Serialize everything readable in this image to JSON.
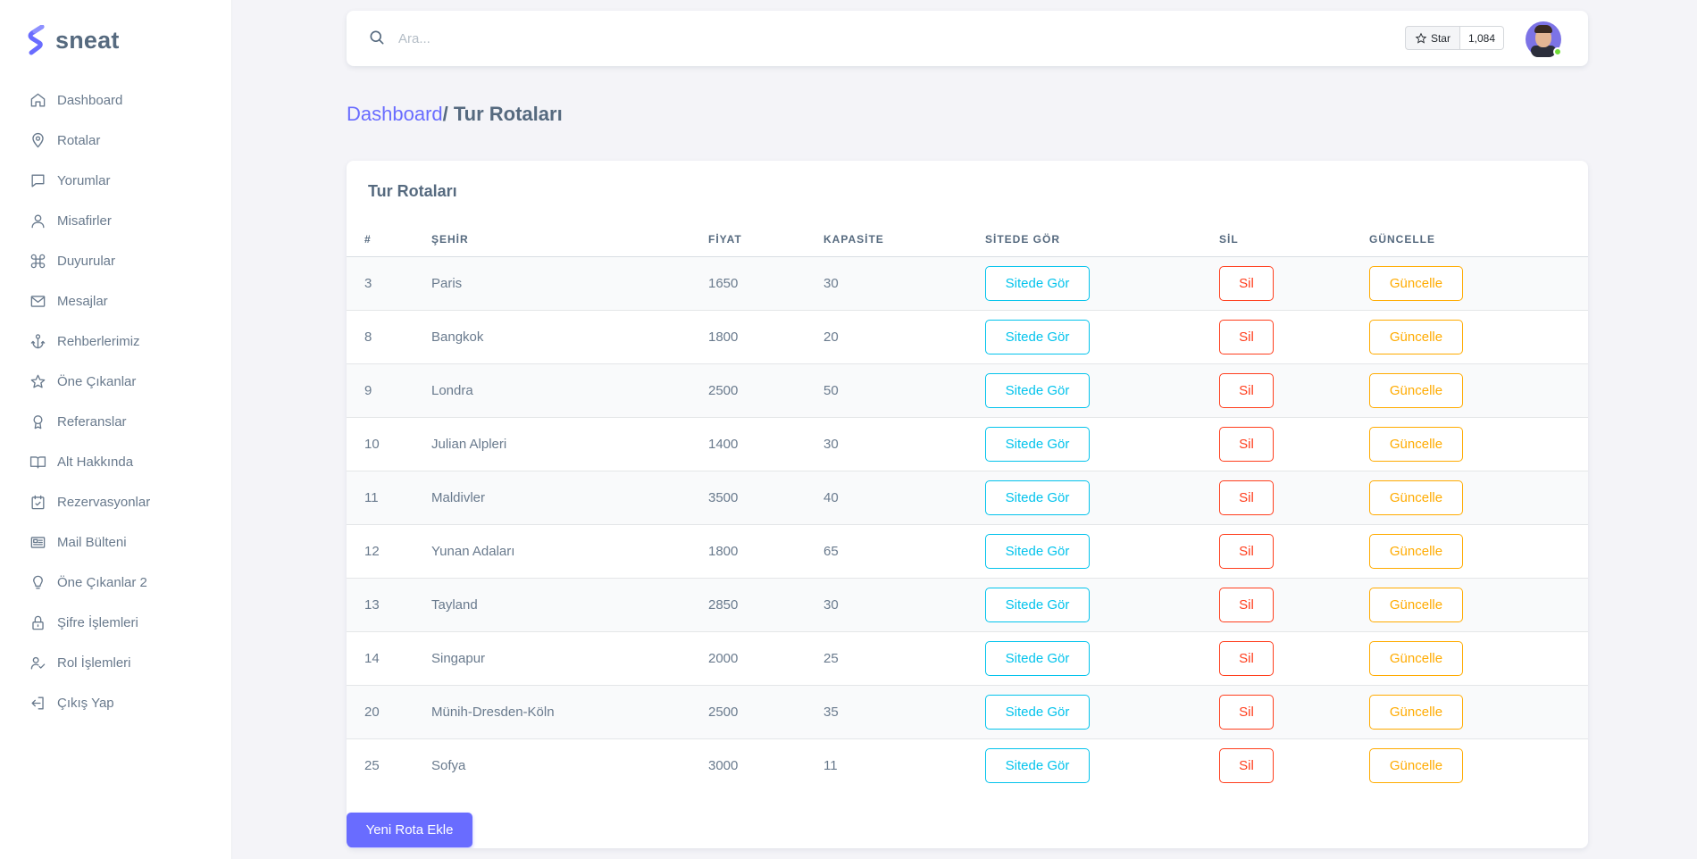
{
  "brand": {
    "name": "sneat"
  },
  "sidebar": {
    "items": [
      {
        "label": "Dashboard",
        "icon": "home-icon"
      },
      {
        "label": "Rotalar",
        "icon": "map-pin-icon"
      },
      {
        "label": "Yorumlar",
        "icon": "message-square-icon"
      },
      {
        "label": "Misafirler",
        "icon": "user-icon"
      },
      {
        "label": "Duyurular",
        "icon": "command-icon"
      },
      {
        "label": "Mesajlar",
        "icon": "envelope-icon"
      },
      {
        "label": "Rehberlerimiz",
        "icon": "anchor-icon"
      },
      {
        "label": "Öne Çıkanlar",
        "icon": "star-icon"
      },
      {
        "label": "Referanslar",
        "icon": "award-icon"
      },
      {
        "label": "Alt Hakkında",
        "icon": "book-open-icon"
      },
      {
        "label": "Rezervasyonlar",
        "icon": "calendar-check-icon"
      },
      {
        "label": "Mail Bülteni",
        "icon": "news-icon"
      },
      {
        "label": "Öne Çıkanlar 2",
        "icon": "bulb-icon"
      },
      {
        "label": "Şifre İşlemleri",
        "icon": "lock-icon"
      },
      {
        "label": "Rol İşlemleri",
        "icon": "user-check-icon"
      },
      {
        "label": "Çıkış Yap",
        "icon": "log-out-icon"
      }
    ]
  },
  "navbar": {
    "search_placeholder": "Ara...",
    "github": {
      "star_label": "Star",
      "count": "1,084"
    }
  },
  "breadcrumb": {
    "parent": "Dashboard",
    "current": "/ Tur Rotaları"
  },
  "card": {
    "title": "Tur Rotaları",
    "columns": [
      "#",
      "ŞEHİR",
      "FİYAT",
      "KAPASİTE",
      "SİTEDE GÖR",
      "SİL",
      "GÜNCELLE"
    ],
    "rows": [
      {
        "id": "3",
        "city": "Paris",
        "price": "1650",
        "capacity": "30"
      },
      {
        "id": "8",
        "city": "Bangkok",
        "price": "1800",
        "capacity": "20"
      },
      {
        "id": "9",
        "city": "Londra",
        "price": "2500",
        "capacity": "50"
      },
      {
        "id": "10",
        "city": "Julian Alpleri",
        "price": "1400",
        "capacity": "30"
      },
      {
        "id": "11",
        "city": "Maldivler",
        "price": "3500",
        "capacity": "40"
      },
      {
        "id": "12",
        "city": "Yunan Adaları",
        "price": "1800",
        "capacity": "65"
      },
      {
        "id": "13",
        "city": "Tayland",
        "price": "2850",
        "capacity": "30"
      },
      {
        "id": "14",
        "city": "Singapur",
        "price": "2000",
        "capacity": "25"
      },
      {
        "id": "20",
        "city": "Münih-Dresden-Köln",
        "price": "2500",
        "capacity": "35"
      },
      {
        "id": "25",
        "city": "Sofya",
        "price": "3000",
        "capacity": "11"
      }
    ],
    "buttons": {
      "view": "Sitede Gör",
      "delete": "Sil",
      "update": "Güncelle"
    },
    "add_button": "Yeni Rota Ekle"
  },
  "colors": {
    "primary": "#696cff",
    "info": "#03c3ec",
    "danger": "#ff3e1d",
    "warning": "#ffab00",
    "online": "#71dd37"
  }
}
